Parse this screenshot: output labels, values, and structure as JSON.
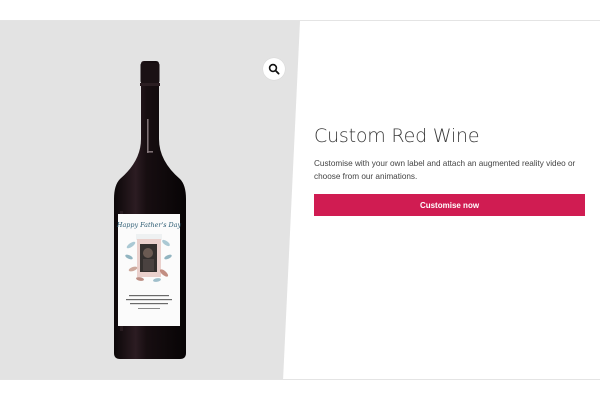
{
  "product": {
    "title": "Custom Red Wine",
    "description": "Customise with your own label and attach an augmented reality video or choose from our animations.",
    "cta_label": "Customise now"
  },
  "label": {
    "script_text": "Happy Father's Day"
  },
  "icons": {
    "zoom": "magnifier-zoom-icon"
  },
  "colors": {
    "cta": "#d01c52",
    "gallery_bg": "#e3e3e3",
    "bottle": "#140d10",
    "title": "#3a3a3a"
  }
}
